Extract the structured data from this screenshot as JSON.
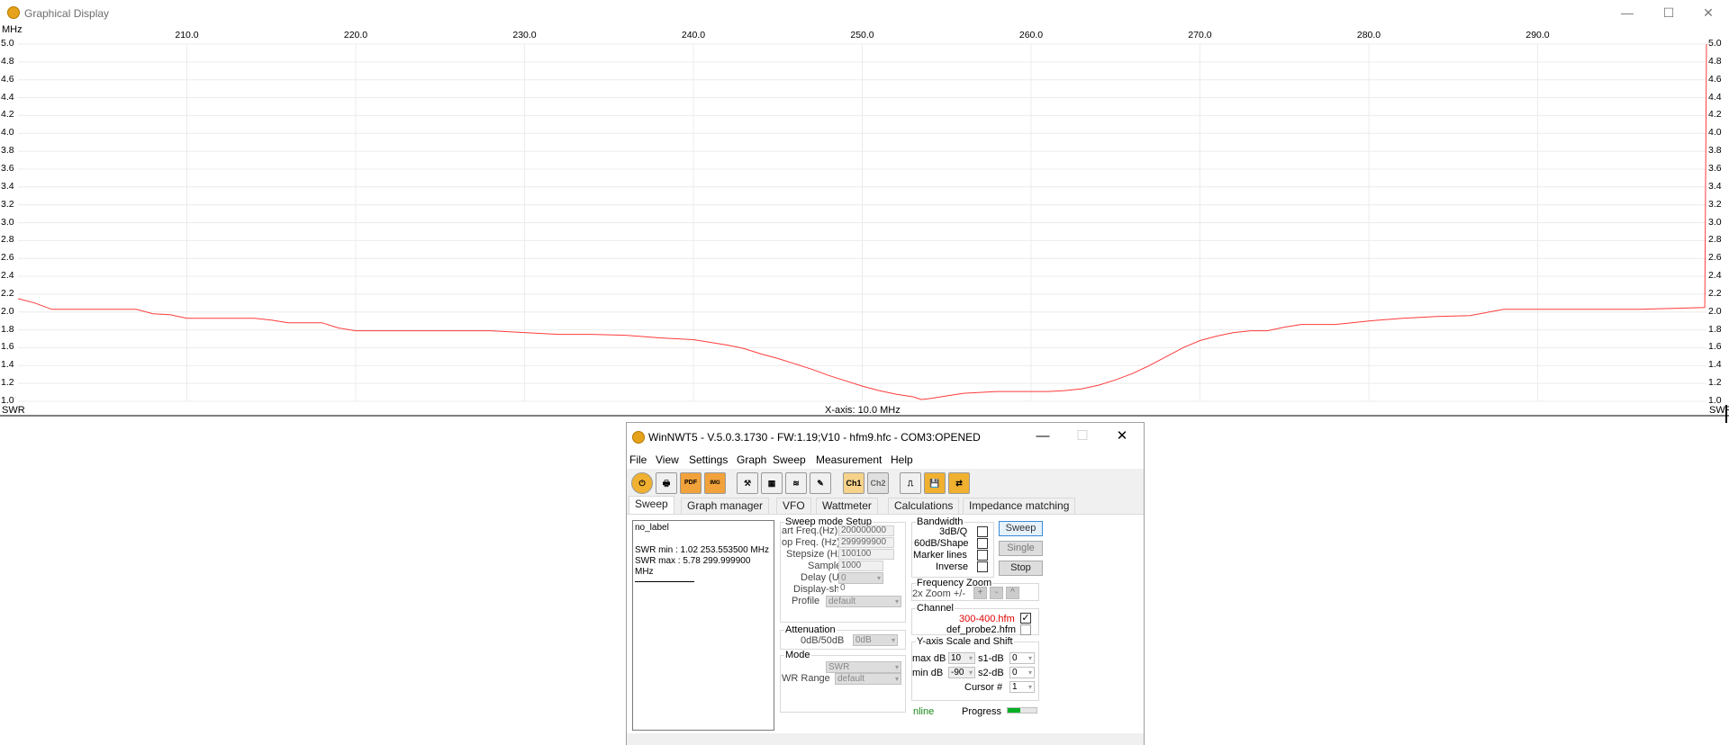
{
  "graph_window": {
    "title": "Graphical Display",
    "controls": {
      "minimize": "—",
      "maximize": "☐",
      "close": "✕"
    }
  },
  "chart_data": {
    "type": "line",
    "top_left_unit": "MHz",
    "xlabel": "X-axis: 10.0 MHz",
    "ylabel": "SWR",
    "xlim": [
      200.0,
      300.0
    ],
    "ylim": [
      1.0,
      5.0
    ],
    "x_ticks": [
      "210.0",
      "220.0",
      "230.0",
      "240.0",
      "250.0",
      "260.0",
      "270.0",
      "280.0",
      "290.0"
    ],
    "y_ticks": [
      "5.0",
      "4.8",
      "4.6",
      "4.4",
      "4.2",
      "4.0",
      "3.8",
      "3.6",
      "3.4",
      "3.2",
      "3.0",
      "2.8",
      "2.6",
      "2.4",
      "2.2",
      "2.0",
      "1.8",
      "1.6",
      "1.4",
      "1.2",
      "1.0"
    ],
    "series": [
      {
        "color": "#ff3b3b",
        "x": [
          200.0,
          201.0,
          202.0,
          204.0,
          206.0,
          207.0,
          208.0,
          209.0,
          210.0,
          212.0,
          214.0,
          215.0,
          216.0,
          218.0,
          219.0,
          220.0,
          222.0,
          224.0,
          226.0,
          228.0,
          230.0,
          232.0,
          234.0,
          236.0,
          238.0,
          240.0,
          241.0,
          242.0,
          243.0,
          244.0,
          245.0,
          246.0,
          247.0,
          248.0,
          249.0,
          250.0,
          251.0,
          252.0,
          253.0,
          253.5,
          254.0,
          255.0,
          256.0,
          257.0,
          258.0,
          259.0,
          260.0,
          261.0,
          262.0,
          263.0,
          264.0,
          265.0,
          266.0,
          267.0,
          268.0,
          269.0,
          270.0,
          271.0,
          272.0,
          273.0,
          274.0,
          275.0,
          276.0,
          277.0,
          278.0,
          279.0,
          280.0,
          282.0,
          284.0,
          286.0,
          288.0,
          290.0,
          292.0,
          294.0,
          296.0,
          298.0,
          299.9,
          300.0
        ],
        "y": [
          2.15,
          2.1,
          2.03,
          2.03,
          2.03,
          2.03,
          1.98,
          1.97,
          1.93,
          1.93,
          1.93,
          1.91,
          1.88,
          1.88,
          1.82,
          1.79,
          1.79,
          1.79,
          1.79,
          1.79,
          1.77,
          1.75,
          1.75,
          1.74,
          1.71,
          1.69,
          1.66,
          1.63,
          1.59,
          1.53,
          1.48,
          1.42,
          1.36,
          1.29,
          1.23,
          1.17,
          1.12,
          1.08,
          1.05,
          1.02,
          1.03,
          1.06,
          1.09,
          1.1,
          1.11,
          1.11,
          1.11,
          1.11,
          1.12,
          1.14,
          1.18,
          1.24,
          1.31,
          1.4,
          1.5,
          1.6,
          1.68,
          1.73,
          1.77,
          1.79,
          1.79,
          1.83,
          1.86,
          1.86,
          1.86,
          1.88,
          1.9,
          1.93,
          1.95,
          1.96,
          2.03,
          2.03,
          2.03,
          2.03,
          2.03,
          2.04,
          2.05,
          5.78
        ]
      }
    ]
  },
  "dialog": {
    "title": "WinNWT5 - V.5.0.3.1730 - FW:1.19;V10 - hfm9.hfc - COM3:OPENED",
    "controls": {
      "minimize": "—",
      "maximize": "☐",
      "close": "✕"
    },
    "menu": [
      "File",
      "View",
      "Settings",
      "Graph",
      "Sweep",
      "Measurement",
      "Help"
    ],
    "toolbar": [
      "power",
      "print",
      "PDF",
      "IMAGE",
      "probe",
      "grid",
      "graph",
      "tools",
      "Ch1",
      "Ch2",
      "sweep-shape",
      "save",
      "exchange"
    ],
    "tabs": [
      "Sweep",
      "Graph manager",
      "VFO",
      "Wattmeter",
      "Calculations",
      "Impedance matching"
    ],
    "info": {
      "label": "no_label",
      "swr_min": "SWR min : 1.02  253.553500 MHz",
      "swr_max": "SWR max : 5.78  299.999900",
      "unit": "MHz"
    },
    "sweep_setup": {
      "title": "Sweep mode Setup",
      "start_label": "art Freq.(Hz)",
      "start_value": "200000000",
      "stop_label": "op Freq. (Hz)",
      "stop_value": "299999900",
      "step_label": "Stepsize (Hz)",
      "step_value": "100100",
      "samples_label": "Samples",
      "samples_value": "1000",
      "delay_label": "Delay (Us)",
      "delay_value": "0",
      "shift_label": "Display-shift",
      "shift_value": "0",
      "profile_label": "Profile",
      "profile_value": "default"
    },
    "attenuation": {
      "title": "Attenuation",
      "label": "0dB/50dB",
      "value": "0dB"
    },
    "mode": {
      "title": "Mode",
      "value": "SWR",
      "range_label": "WR Range",
      "range_value": "default"
    },
    "bandwidth": {
      "title": "Bandwidth",
      "items": [
        "3dB/Q",
        "60dB/Shape",
        "Marker lines",
        "Inverse"
      ]
    },
    "buttons": {
      "sweep": "Sweep",
      "single": "Single",
      "stop": "Stop"
    },
    "zoom": {
      "title": "Frequency Zoom",
      "label": "2x Zoom +/-",
      "plus": "+",
      "minus": "-",
      "reset": "^"
    },
    "channel": {
      "title": "Channel",
      "file1": "300-400.hfm",
      "file2": "def_probe2.hfm",
      "file1_checked": "✓"
    },
    "yaxis": {
      "title": "Y-axis Scale and Shift",
      "max_label": "max dB",
      "max_value": "10",
      "min_label": "min dB",
      "min_value": "-90",
      "s1_label": "s1-dB",
      "s1_value": "0",
      "s2_label": "s2-dB",
      "s2_value": "0",
      "cursor_label": "Cursor #",
      "cursor_value": "1"
    },
    "status": {
      "online": "nline",
      "progress_label": "Progress",
      "progress": 0.45,
      "online_color": "#1a8a1a"
    }
  }
}
